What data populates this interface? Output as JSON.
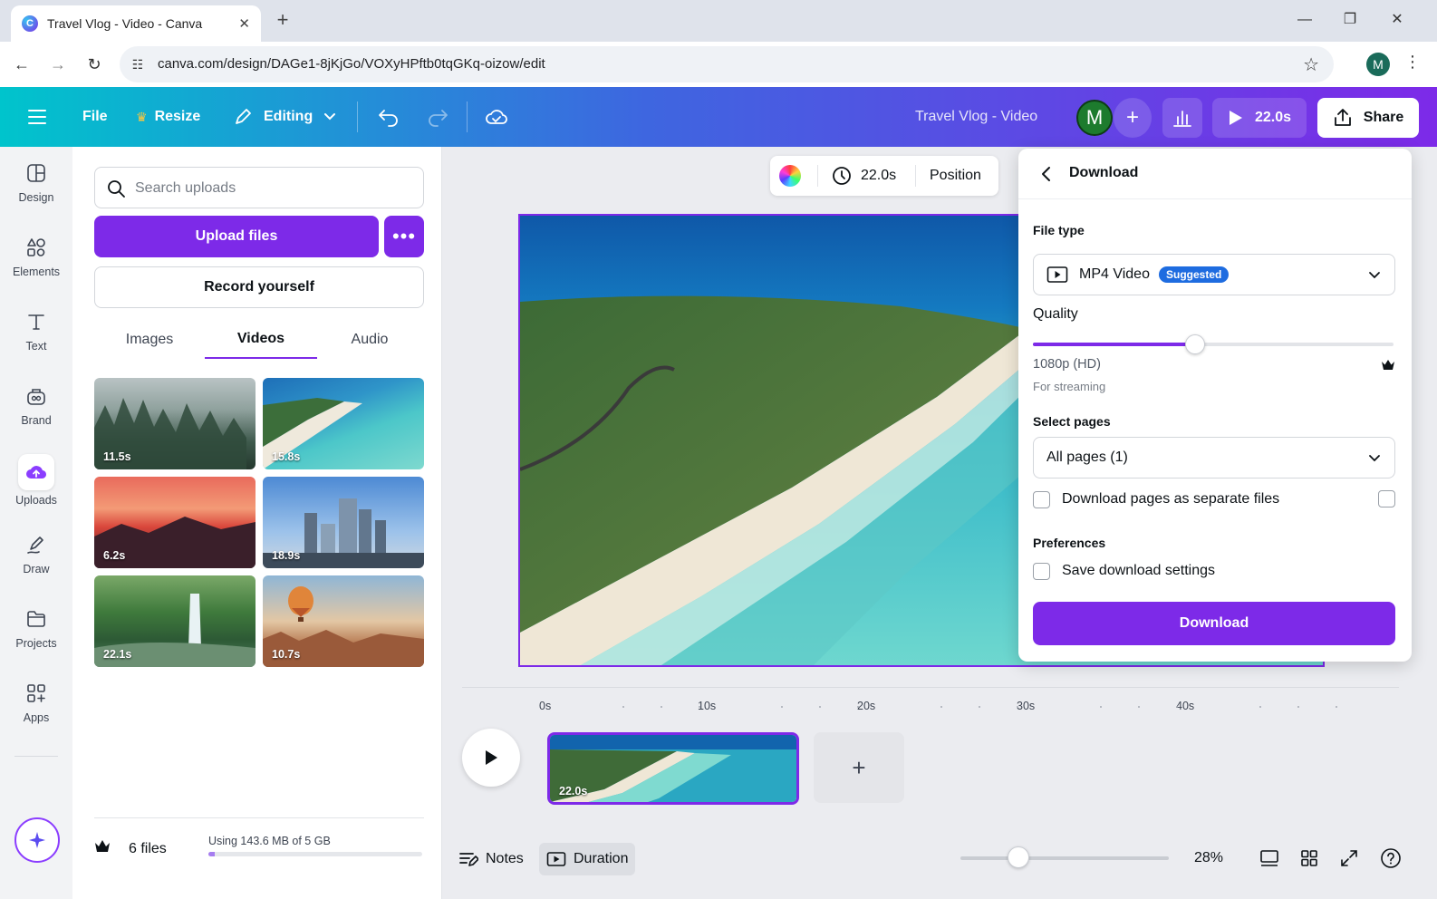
{
  "browser": {
    "tab_title": "Travel Vlog - Video - Canva",
    "favicon_letter": "C",
    "url": "canva.com/design/DAGe1-8jKjGo/VOXyHPftb0tqGKq-oizow/edit",
    "profile_initial": "M"
  },
  "header": {
    "file_label": "File",
    "resize_label": "Resize",
    "editing_label": "Editing",
    "design_title": "Travel Vlog - Video",
    "collaborator_initial": "M",
    "play_duration": "22.0s",
    "share_label": "Share",
    "brand_color": "#7d2ae8"
  },
  "rail": {
    "items": [
      {
        "label": "Design",
        "icon": "layout-icon"
      },
      {
        "label": "Elements",
        "icon": "shapes-icon"
      },
      {
        "label": "Text",
        "icon": "text-icon"
      },
      {
        "label": "Brand",
        "icon": "brand-icon"
      },
      {
        "label": "Uploads",
        "icon": "upload-cloud-icon",
        "active": true
      },
      {
        "label": "Draw",
        "icon": "pen-icon"
      },
      {
        "label": "Projects",
        "icon": "folder-icon"
      },
      {
        "label": "Apps",
        "icon": "apps-icon"
      }
    ]
  },
  "uploads": {
    "search_placeholder": "Search uploads",
    "upload_button": "Upload files",
    "record_button": "Record yourself",
    "tabs": [
      "Images",
      "Videos",
      "Audio"
    ],
    "active_tab": "Videos",
    "videos": [
      {
        "duration": "11.5s",
        "subject": "misty forest"
      },
      {
        "duration": "15.8s",
        "subject": "tropical beach"
      },
      {
        "duration": "6.2s",
        "subject": "sunset lake"
      },
      {
        "duration": "18.9s",
        "subject": "city skyline"
      },
      {
        "duration": "22.1s",
        "subject": "waterfall"
      },
      {
        "duration": "10.7s",
        "subject": "hot air balloon"
      }
    ],
    "file_count": "6 files",
    "storage_usage": "Using 143.6 MB of 5 GB",
    "storage_fraction": 0.028
  },
  "canvas": {
    "toolbar_duration": "22.0s",
    "toolbar_position": "Position",
    "timeline_labels": [
      "0s",
      "10s",
      "20s",
      "30s",
      "40s"
    ],
    "clip_duration": "22.0s",
    "notes_label": "Notes",
    "duration_label": "Duration",
    "zoom": "28%"
  },
  "download": {
    "title": "Download",
    "file_type_label": "File type",
    "file_type_value": "MP4 Video",
    "suggested_badge": "Suggested",
    "quality_label": "Quality",
    "quality_value": "1080p (HD)",
    "quality_hint": "For streaming",
    "quality_fraction": 0.45,
    "select_pages_label": "Select pages",
    "select_pages_value": "All pages (1)",
    "separate_files_label": "Download pages as separate files",
    "preferences_label": "Preferences",
    "save_settings_label": "Save download settings",
    "download_button": "Download"
  }
}
